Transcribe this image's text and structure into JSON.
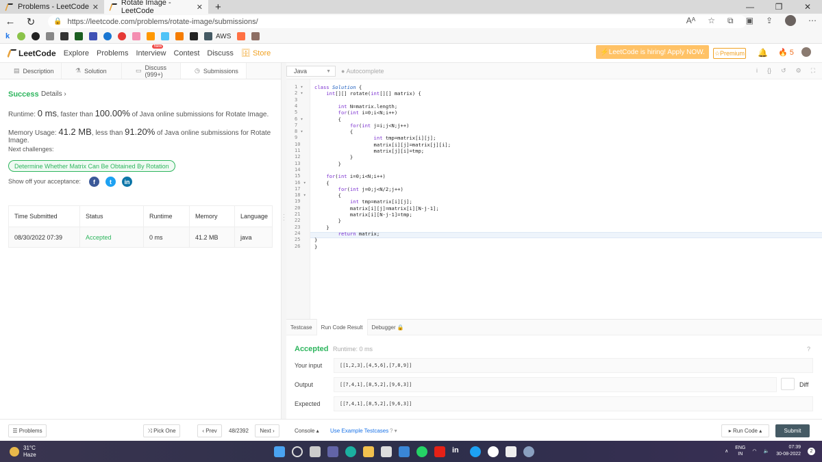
{
  "browser": {
    "tabs": [
      {
        "title": "Problems - LeetCode",
        "active": false
      },
      {
        "title": "Rotate Image - LeetCode",
        "active": true
      }
    ],
    "new_tab": "+",
    "url": "https://leetcode.com/problems/rotate-image/submissions/",
    "bookmark_label": "AWS",
    "window_controls": [
      "—",
      "❐",
      "✕"
    ]
  },
  "lc_nav": {
    "logo": "LeetCode",
    "links": [
      "Explore",
      "Problems",
      "Interview",
      "Contest",
      "Discuss"
    ],
    "new_badge": "New",
    "store": "Store",
    "hiring": "LeetCode is hiring! Apply NOW.",
    "premium": "Premium",
    "streak": "5"
  },
  "left_tabs": [
    "Description",
    "Solution",
    "Discuss (999+)",
    "Submissions"
  ],
  "result": {
    "status": "Success",
    "details": "Details",
    "runtime_pre": "Runtime:",
    "runtime_val": "0 ms",
    "runtime_mid": ", faster than",
    "runtime_pct": "100.00%",
    "runtime_post": "of Java online submissions for Rotate Image.",
    "memory_pre": "Memory Usage:",
    "memory_val": "41.2 MB",
    "memory_mid": ", less than",
    "memory_pct": "91.20%",
    "memory_post": "of Java online submissions for Rotate Image.",
    "next_challenges": "Next challenges:",
    "challenge": "Determine Whether Matrix Can Be Obtained By Rotation",
    "show_off": "Show off your acceptance:"
  },
  "table": {
    "headers": [
      "Time Submitted",
      "Status",
      "Runtime",
      "Memory",
      "Language"
    ],
    "row": [
      "08/30/2022 07:39",
      "Accepted",
      "0 ms",
      "41.2 MB",
      "java"
    ]
  },
  "editor": {
    "language": "Java",
    "autocomplete": "Autocomplete",
    "lines": [
      "class Solution {",
      "    int[][] rotate(int[][] matrix) {",
      "",
      "        int N=matrix.length;",
      "        for(int i=0;i<N;i++)",
      "        {",
      "            for(int j=i;j<N;j++)",
      "            {",
      "                    int tmp=matrix[i][j];",
      "                    matrix[i][j]=matrix[j][i];",
      "                    matrix[j][i]=tmp;",
      "            }",
      "        }",
      "",
      "    for(int i=0;i<N;i++)",
      "    {",
      "        for(int j=0;j<N/2;j++)",
      "        {",
      "            int tmp=matrix[i][j];",
      "            matrix[i][j]=matrix[i][N-j-1];",
      "            matrix[i][N-j-1]=tmp;",
      "        }",
      "    }",
      "        return matrix;",
      "}",
      "}"
    ],
    "fold_lines": [
      1,
      2,
      6,
      8,
      16,
      18
    ]
  },
  "bottom": {
    "tabs": [
      "Testcase",
      "Run Code Result",
      "Debugger"
    ],
    "status": "Accepted",
    "runtime": "Runtime: 0 ms",
    "labels": [
      "Your input",
      "Output",
      "Expected"
    ],
    "input": "[[1,2,3],[4,5,6],[7,8,9]]",
    "output": "[[7,4,1],[8,5,2],[9,6,3]]",
    "expected": "[[7,4,1],[8,5,2],[9,6,3]]",
    "diff": "Diff"
  },
  "footer": {
    "problems": "Problems",
    "pick_one": "Pick One",
    "prev": "Prev",
    "page": "48/2392",
    "next": "Next",
    "console": "Console",
    "use_example": "Use Example Testcases",
    "run_code": "Run Code",
    "submit": "Submit"
  },
  "taskbar": {
    "temp": "31°C",
    "weather": "Haze",
    "lang": "ENG",
    "region": "IN",
    "time": "07:39",
    "date": "30-08-2022",
    "notif": "2"
  }
}
